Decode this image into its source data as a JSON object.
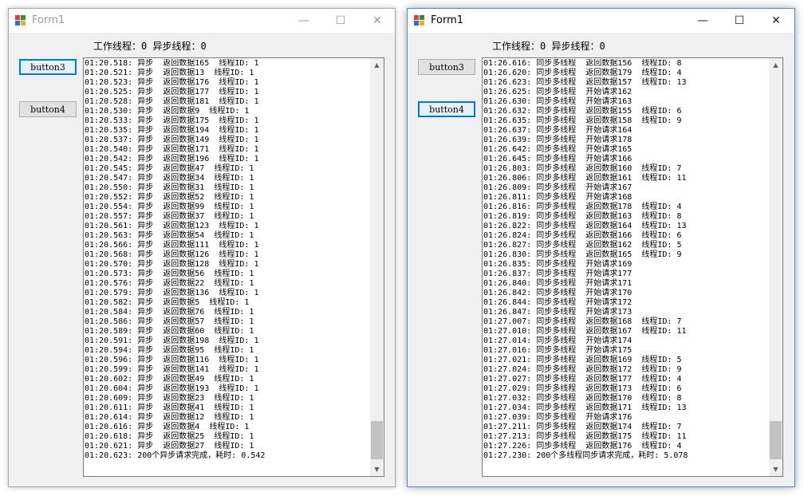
{
  "icons": {
    "title": "winforms-app-icon",
    "minimize": "minimize-icon",
    "maximize": "maximize-icon",
    "close": "close-icon",
    "scroll_up": "scroll-up-arrow-icon",
    "scroll_down": "scroll-down-arrow-icon"
  },
  "colors": {
    "accent": "#0078d7",
    "window_bg": "#f0f0f0",
    "inactive_title": "#9a9a9a"
  },
  "windows": [
    {
      "title": "Form1",
      "controls": {
        "minimize": "—",
        "maximize": "☐",
        "close": "✕"
      },
      "status": "工作线程：0 异步线程：0",
      "buttons": [
        "button3",
        "button4"
      ],
      "log": [
        "01:20.518: 异步  返回数据165  线程ID: 1",
        "01:20.521: 异步  返回数据13  线程ID: 1",
        "01:20.523: 异步  返回数据176  线程ID: 1",
        "01:20.525: 异步  返回数据177  线程ID: 1",
        "01:20.528: 异步  返回数据181  线程ID: 1",
        "01:20.530: 异步  返回数据9  线程ID: 1",
        "01:20.533: 异步  返回数据175  线程ID: 1",
        "01:20.535: 异步  返回数据194  线程ID: 1",
        "01:20.537: 异步  返回数据149  线程ID: 1",
        "01:20.540: 异步  返回数据171  线程ID: 1",
        "01:20.542: 异步  返回数据196  线程ID: 1",
        "01:20.545: 异步  返回数据47  线程ID: 1",
        "01:20.547: 异步  返回数据34  线程ID: 1",
        "01:20.550: 异步  返回数据31  线程ID: 1",
        "01:20.552: 异步  返回数据52  线程ID: 1",
        "01:20.554: 异步  返回数据99  线程ID: 1",
        "01:20.557: 异步  返回数据37  线程ID: 1",
        "01:20.561: 异步  返回数据123  线程ID: 1",
        "01:20.563: 异步  返回数据54  线程ID: 1",
        "01:20.566: 异步  返回数据111  线程ID: 1",
        "01:20.568: 异步  返回数据126  线程ID: 1",
        "01:20.570: 异步  返回数据128  线程ID: 1",
        "01:20.573: 异步  返回数据56  线程ID: 1",
        "01:20.576: 异步  返回数据22  线程ID: 1",
        "01:20.579: 异步  返回数据136  线程ID: 1",
        "01:20.582: 异步  返回数据5  线程ID: 1",
        "01:20.584: 异步  返回数据76  线程ID: 1",
        "01:20.586: 异步  返回数据57  线程ID: 1",
        "01:20.589: 异步  返回数据60  线程ID: 1",
        "01:20.591: 异步  返回数据198  线程ID: 1",
        "01:20.594: 异步  返回数据95  线程ID: 1",
        "01:20.596: 异步  返回数据116  线程ID: 1",
        "01:20.599: 异步  返回数据141  线程ID: 1",
        "01:20.602: 异步  返回数据49  线程ID: 1",
        "01:20.604: 异步  返回数据193  线程ID: 1",
        "01:20.609: 异步  返回数据23  线程ID: 1",
        "01:20.611: 异步  返回数据41  线程ID: 1",
        "01:20.614: 异步  返回数据12  线程ID: 1",
        "01:20.616: 异步  返回数据4  线程ID: 1",
        "01:20.618: 异步  返回数据25  线程ID: 1",
        "01:20.621: 异步  返回数据27  线程ID: 1",
        "01:20.623: 200个异步请求完成，耗时: 0.542"
      ]
    },
    {
      "title": "Form1",
      "controls": {
        "minimize": "—",
        "maximize": "☐",
        "close": "✕"
      },
      "status": "工作线程：0 异步线程：0",
      "buttons": [
        "button3",
        "button4"
      ],
      "log": [
        "01:26.616: 同步多线程  返回数据156  线程ID: 8",
        "01:26.620: 同步多线程  返回数据179  线程ID: 4",
        "01:26.623: 同步多线程  返回数据157  线程ID: 13",
        "01:26.625: 同步多线程  开始请求162",
        "01:26.630: 同步多线程  开始请求163",
        "01:26.632: 同步多线程  返回数据155  线程ID: 6",
        "01:26.635: 同步多线程  返回数据158  线程ID: 9",
        "01:26.637: 同步多线程  开始请求164",
        "01:26.639: 同步多线程  开始请求178",
        "01:26.642: 同步多线程  开始请求165",
        "01:26.645: 同步多线程  开始请求166",
        "01:26.803: 同步多线程  返回数据160  线程ID: 7",
        "01:26.806: 同步多线程  返回数据161  线程ID: 11",
        "01:26.809: 同步多线程  开始请求167",
        "01:26.811: 同步多线程  开始请求168",
        "01:26.816: 同步多线程  返回数据178  线程ID: 4",
        "01:26.819: 同步多线程  返回数据163  线程ID: 8",
        "01:26.822: 同步多线程  返回数据164  线程ID: 13",
        "01:26.824: 同步多线程  返回数据166  线程ID: 6",
        "01:26.827: 同步多线程  返回数据162  线程ID: 5",
        "01:26.830: 同步多线程  返回数据165  线程ID: 9",
        "01:26.835: 同步多线程  开始请求169",
        "01:26.837: 同步多线程  开始请求177",
        "01:26.840: 同步多线程  开始请求171",
        "01:26.842: 同步多线程  开始请求170",
        "01:26.844: 同步多线程  开始请求172",
        "01:26.847: 同步多线程  开始请求173",
        "01:27.007: 同步多线程  返回数据168  线程ID: 7",
        "01:27.010: 同步多线程  返回数据167  线程ID: 11",
        "01:27.014: 同步多线程  开始请求174",
        "01:27.016: 同步多线程  开始请求175",
        "01:27.021: 同步多线程  返回数据169  线程ID: 5",
        "01:27.024: 同步多线程  返回数据172  线程ID: 9",
        "01:27.027: 同步多线程  返回数据177  线程ID: 4",
        "01:27.029: 同步多线程  返回数据173  线程ID: 6",
        "01:27.032: 同步多线程  返回数据170  线程ID: 8",
        "01:27.034: 同步多线程  返回数据171  线程ID: 13",
        "01:27.039: 同步多线程  开始请求176",
        "01:27.211: 同步多线程  返回数据174  线程ID: 7",
        "01:27.213: 同步多线程  返回数据175  线程ID: 11",
        "01:27.226: 同步多线程  返回数据176  线程ID: 4",
        "01:27.230: 200个多线程同步请求完成，耗时: 5.078"
      ]
    }
  ]
}
